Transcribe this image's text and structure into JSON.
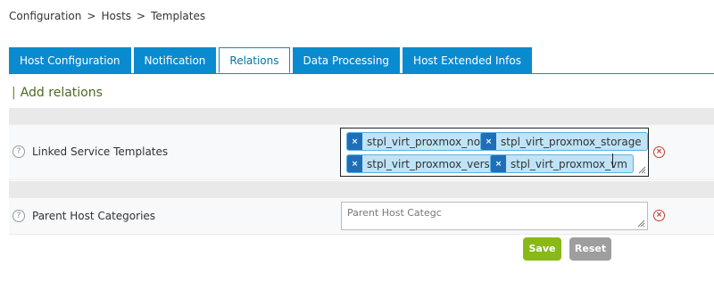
{
  "breadcrumb": {
    "items": [
      "Configuration",
      "Hosts",
      "Templates"
    ],
    "separator": ">"
  },
  "tabs": [
    {
      "label": "Host Configuration",
      "active": false
    },
    {
      "label": "Notification",
      "active": false
    },
    {
      "label": "Relations",
      "active": true
    },
    {
      "label": "Data Processing",
      "active": false
    },
    {
      "label": "Host Extended Infos",
      "active": false
    }
  ],
  "section": {
    "bar": "|",
    "title": "Add relations"
  },
  "fields": {
    "linked_service_templates": {
      "label": "Linked Service Templates",
      "chips": [
        "stpl_virt_proxmox_node",
        "stpl_virt_proxmox_storage",
        "stpl_virt_proxmox_version",
        "stpl_virt_proxmox_vm"
      ],
      "chip_remove_glyph": "×"
    },
    "parent_host_categories": {
      "label": "Parent Host Categories",
      "placeholder": "Parent Host Categc"
    }
  },
  "icons": {
    "help_glyph": "?",
    "clear_glyph": "×"
  },
  "actions": {
    "save_label": "Save",
    "reset_label": "Reset"
  },
  "colors": {
    "tab_blue": "#0a8bd0",
    "chip_bg": "#bfe3f7",
    "chip_x_bg": "#1f6fb8",
    "save_green": "#88b917",
    "reset_gray": "#9e9e9e",
    "clear_red": "#c0392b",
    "section_green": "#4a6b1f"
  }
}
